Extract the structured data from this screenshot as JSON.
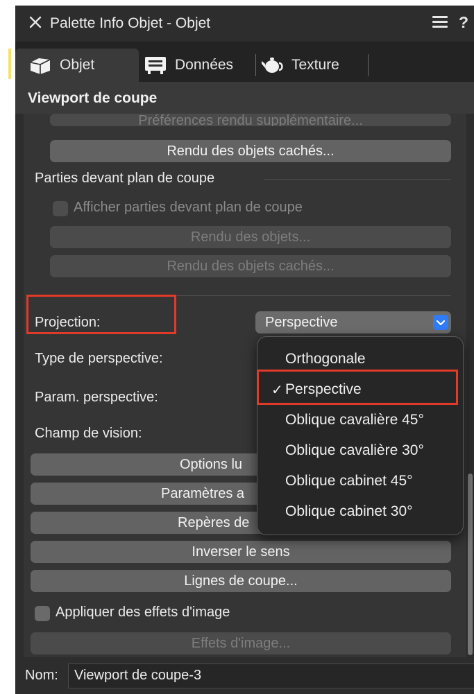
{
  "palette": {
    "title": "Palette Info Objet - Objet",
    "help": "?"
  },
  "tabs": [
    {
      "label": "Objet",
      "icon": "object-icon"
    },
    {
      "label": "Données",
      "icon": "data-icon"
    },
    {
      "label": "Texture",
      "icon": "teapot-icon"
    }
  ],
  "section": {
    "title": "Viewport de coupe"
  },
  "content": {
    "pref_button": "Préférences rendu supplémentaire...",
    "hidden_render_button": "Rendu des objets cachés...",
    "front_parts_group": "Parties devant plan de coupe",
    "show_front_parts_checkbox": "Afficher parties devant plan de coupe",
    "render_objects_button": "Rendu des objets...",
    "render_hidden_objects_button": "Rendu des objets cachés...",
    "projection_label": "Projection:",
    "projection_value": "Perspective",
    "perspective_type_label": "Type de perspective:",
    "perspective_params_label": "Param. perspective:",
    "field_of_view_label": "Champ de vision:",
    "lighting_options_button": "Options lu",
    "advanced_params_button": "Paramètres a",
    "markers_button": "Repères de",
    "invert_button": "Inverser le sens",
    "section_lines_button": "Lignes de coupe...",
    "image_effects_checkbox": "Appliquer des effets d'image",
    "image_effects_button": "Effets d'image..."
  },
  "footer": {
    "name_label": "Nom:",
    "name_value": "Viewport de coupe-3"
  },
  "dropdown": {
    "selected_index": 1,
    "check_mark": "✓",
    "items": [
      "Orthogonale",
      "Perspective",
      "Oblique cavalière 45°",
      "Oblique cavalière 30°",
      "Oblique cabinet 45°",
      "Oblique cabinet 30°"
    ]
  },
  "colors": {
    "panel_bg": "#2d2d2d",
    "content_bg": "#353535",
    "button_bg": "#636363",
    "accent_blue": "#2f7cf6",
    "highlight_red": "#e23a28"
  }
}
